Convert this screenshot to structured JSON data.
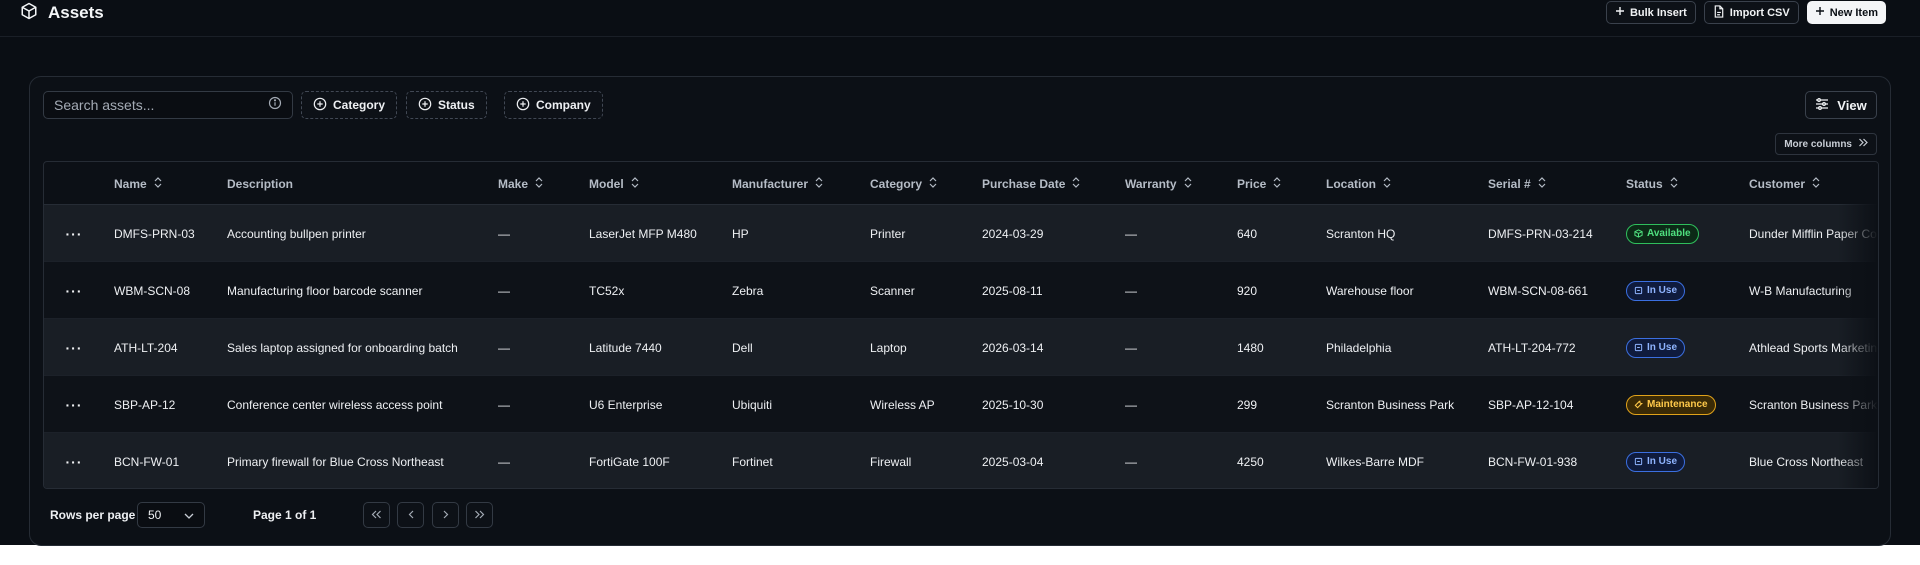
{
  "header": {
    "title": "Assets",
    "bulk_insert_label": "Bulk Insert",
    "import_csv_label": "Import CSV",
    "new_item_label": "New Item"
  },
  "toolbar": {
    "search_placeholder": "Search assets...",
    "filters": [
      "Category",
      "Status",
      "Company"
    ],
    "view_label": "View",
    "more_columns_label": "More columns"
  },
  "table": {
    "columns": [
      "Name",
      "Description",
      "Make",
      "Model",
      "Manufacturer",
      "Category",
      "Purchase Date",
      "Warranty",
      "Price",
      "Location",
      "Serial #",
      "Status",
      "Customer"
    ],
    "rows": [
      {
        "name": "DMFS-PRN-03",
        "description": "Accounting bullpen printer",
        "make": "—",
        "model": "LaserJet MFP M480",
        "manufacturer": "HP",
        "category": "Printer",
        "purchase_date": "2024-03-29",
        "warranty": "—",
        "price": "640",
        "location": "Scranton HQ",
        "serial": "DMFS-PRN-03-214",
        "status": "Available",
        "customer": "Dunder Mifflin Paper Co"
      },
      {
        "name": "WBM-SCN-08",
        "description": "Manufacturing floor barcode scanner",
        "make": "—",
        "model": "TC52x",
        "manufacturer": "Zebra",
        "category": "Scanner",
        "purchase_date": "2025-08-11",
        "warranty": "—",
        "price": "920",
        "location": "Warehouse floor",
        "serial": "WBM-SCN-08-661",
        "status": "In Use",
        "customer": "W-B Manufacturing"
      },
      {
        "name": "ATH-LT-204",
        "description": "Sales laptop assigned for onboarding batch",
        "make": "—",
        "model": "Latitude 7440",
        "manufacturer": "Dell",
        "category": "Laptop",
        "purchase_date": "2026-03-14",
        "warranty": "—",
        "price": "1480",
        "location": "Philadelphia",
        "serial": "ATH-LT-204-772",
        "status": "In Use",
        "customer": "Athlead Sports Marketing"
      },
      {
        "name": "SBP-AP-12",
        "description": "Conference center wireless access point",
        "make": "—",
        "model": "U6 Enterprise",
        "manufacturer": "Ubiquiti",
        "category": "Wireless AP",
        "purchase_date": "2025-10-30",
        "warranty": "—",
        "price": "299",
        "location": "Scranton Business Park",
        "serial": "SBP-AP-12-104",
        "status": "Maintenance",
        "customer": "Scranton Business Park"
      },
      {
        "name": "BCN-FW-01",
        "description": "Primary firewall for Blue Cross Northeast",
        "make": "—",
        "model": "FortiGate 100F",
        "manufacturer": "Fortinet",
        "category": "Firewall",
        "purchase_date": "2025-03-04",
        "warranty": "—",
        "price": "4250",
        "location": "Wilkes-Barre MDF",
        "serial": "BCN-FW-01-938",
        "status": "In Use",
        "customer": "Blue Cross Northeast"
      }
    ]
  },
  "pagination": {
    "rows_per_page_label": "Rows per page",
    "rows_per_page_value": "50",
    "page_info": "Page 1 of 1"
  },
  "colors": {
    "background": "#0a0e14",
    "available": "#2fbf5c",
    "in_use": "#3b6fe0",
    "maintenance": "#e0a21a"
  }
}
